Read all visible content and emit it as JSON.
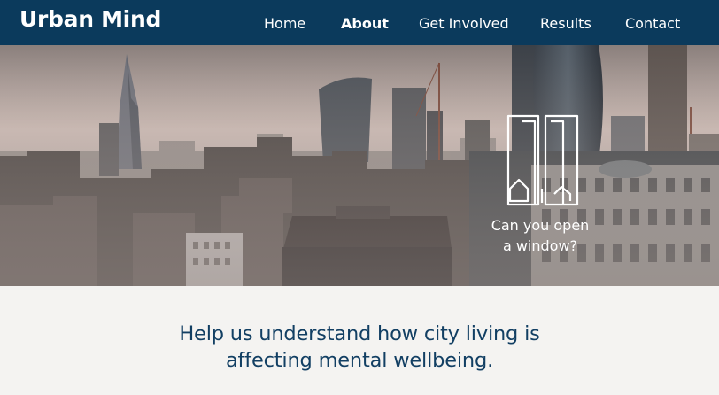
{
  "header": {
    "logo_text": "Urban Mind",
    "bg_color": "#0b3a5c",
    "nav": [
      {
        "label": "Home",
        "active": false
      },
      {
        "label": "About",
        "active": true
      },
      {
        "label": "Get Involved",
        "active": false
      },
      {
        "label": "Results",
        "active": false
      },
      {
        "label": "Contact",
        "active": false
      }
    ]
  },
  "hero": {
    "image": "city-skyline-photo",
    "overlay_icon": "window-buildings-icon",
    "overlay_line1": "Can you open",
    "overlay_line2": "a window?"
  },
  "main": {
    "tagline_line1": "Help us understand how city living is",
    "tagline_line2": "affecting mental wellbeing.",
    "text_color": "#123f63",
    "bg_color": "#f4f3f1"
  }
}
